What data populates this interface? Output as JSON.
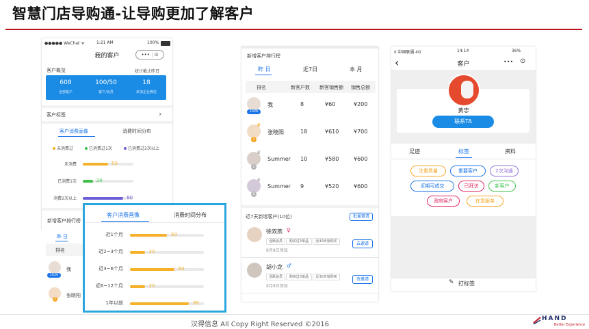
{
  "slide": {
    "title": "智慧门店导购通-让导购更加了解客户",
    "footer": "汉得信息 All Copy Right Reserved ©2016",
    "logo_text": "HAND",
    "logo_sub": "Better Experience"
  },
  "phone1": {
    "status_left": "●●●●● WeChat ᯤ",
    "status_time": "1:21 AM",
    "status_right": "100%",
    "title": "我的客户",
    "capsule_more": "•••",
    "capsule_target": "⊙",
    "overview_label": "客户概览",
    "overview_note": "统计截止昨日",
    "stats": [
      {
        "value": "608",
        "label": "全部客户"
      },
      {
        "value": "100/50",
        "label": "客户/会员"
      },
      {
        "value": "18",
        "label": "未加企业微信"
      }
    ],
    "tags_label": "客户标签",
    "tags_arrow": "›",
    "tabs": [
      "客户消费画像",
      "消费时间分布"
    ],
    "legend": [
      "未消费过",
      "已消费过1次",
      "已消费过2次以上"
    ],
    "bars": [
      {
        "label": "未消费",
        "value": "50",
        "ratio": 0.5,
        "color": "#f5b12a"
      },
      {
        "label": "已消费1次",
        "value": "20",
        "ratio": 0.2,
        "color": "#3cc24a"
      },
      {
        "label": "消费2次以上",
        "value": "80",
        "ratio": 0.8,
        "color": "#6c5fd6"
      }
    ],
    "rank_title": "新增客户排行榜",
    "rank_tab": "昨 日",
    "rank_col": "排名",
    "rank_rows": [
      {
        "name": "我",
        "badge": "1026"
      },
      {
        "name": "张晓阳",
        "badge": "1"
      }
    ]
  },
  "popup": {
    "tabs": [
      "客户消费画像",
      "消费时间分布"
    ],
    "bars": [
      {
        "label": "近1个月",
        "value": "50",
        "ratio": 0.5
      },
      {
        "label": "近2~3个月",
        "value": "20",
        "ratio": 0.2
      },
      {
        "label": "近3~6个月",
        "value": "60",
        "ratio": 0.6
      },
      {
        "label": "近6~12个月",
        "value": "20",
        "ratio": 0.2
      },
      {
        "label": "1年以前",
        "value": "80",
        "ratio": 0.8
      }
    ],
    "bar_color": "#f5b12a"
  },
  "phone2": {
    "title": "新增客户排行榜",
    "tabs": [
      "昨 日",
      "近7日",
      "本 月"
    ],
    "columns": [
      "排名",
      "新客户数",
      "新客销售额",
      "销售总额"
    ],
    "rows": [
      {
        "name": "我",
        "badge": "1026",
        "new": "8",
        "new_sales": "¥60",
        "total": "¥200"
      },
      {
        "name": "张晓阳",
        "badge": "1",
        "new": "18",
        "new_sales": "¥610",
        "total": "¥700"
      },
      {
        "name": "Summer",
        "badge": "2",
        "new": "10",
        "new_sales": "¥580",
        "total": "¥600"
      },
      {
        "name": "Summer",
        "badge": "3",
        "new": "9",
        "new_sales": "¥520",
        "total": "¥600"
      }
    ],
    "recent_title": "近7天新增客户(10位)",
    "batch_invite": "批量邀请",
    "customers": [
      {
        "name": "徐双燕",
        "gender": "♀",
        "chips": [
          "活跃会员",
          "购买过3单品",
          "近30天有购买"
        ],
        "date": "8月8日添加",
        "action": "去邀请"
      },
      {
        "name": "胡小龙",
        "gender": "♂",
        "chips": [
          "活跃会员",
          "购买过3单品",
          "近30天有购买"
        ],
        "date": "8月8日添加",
        "action": "去邀请"
      }
    ]
  },
  "phone3": {
    "status_left": "中国联通 4G",
    "status_time": "14:14",
    "status_right": "36%",
    "back": "‹",
    "title": "客户",
    "capsule_more": "•••",
    "capsule_target": "⊙",
    "customer_name": "黄忠",
    "contact_btn": "联系TA",
    "tabs": [
      "足迹",
      "标签",
      "资料"
    ],
    "tags": [
      {
        "text": "注重质量",
        "color": "#f5a623"
      },
      {
        "text": "重要客户",
        "color": "#1a73e8"
      },
      {
        "text": "2次沟通",
        "color": "#8e6bd8"
      },
      {
        "text": "近期可成交",
        "color": "#1a73e8"
      },
      {
        "text": "已拜访",
        "color": "#e0245e"
      },
      {
        "text": "新客户",
        "color": "#3cc24a"
      },
      {
        "text": "政府客户",
        "color": "#e0245e"
      },
      {
        "text": "在意服务",
        "color": "#f5a623"
      }
    ],
    "add_tag": "打标签"
  }
}
